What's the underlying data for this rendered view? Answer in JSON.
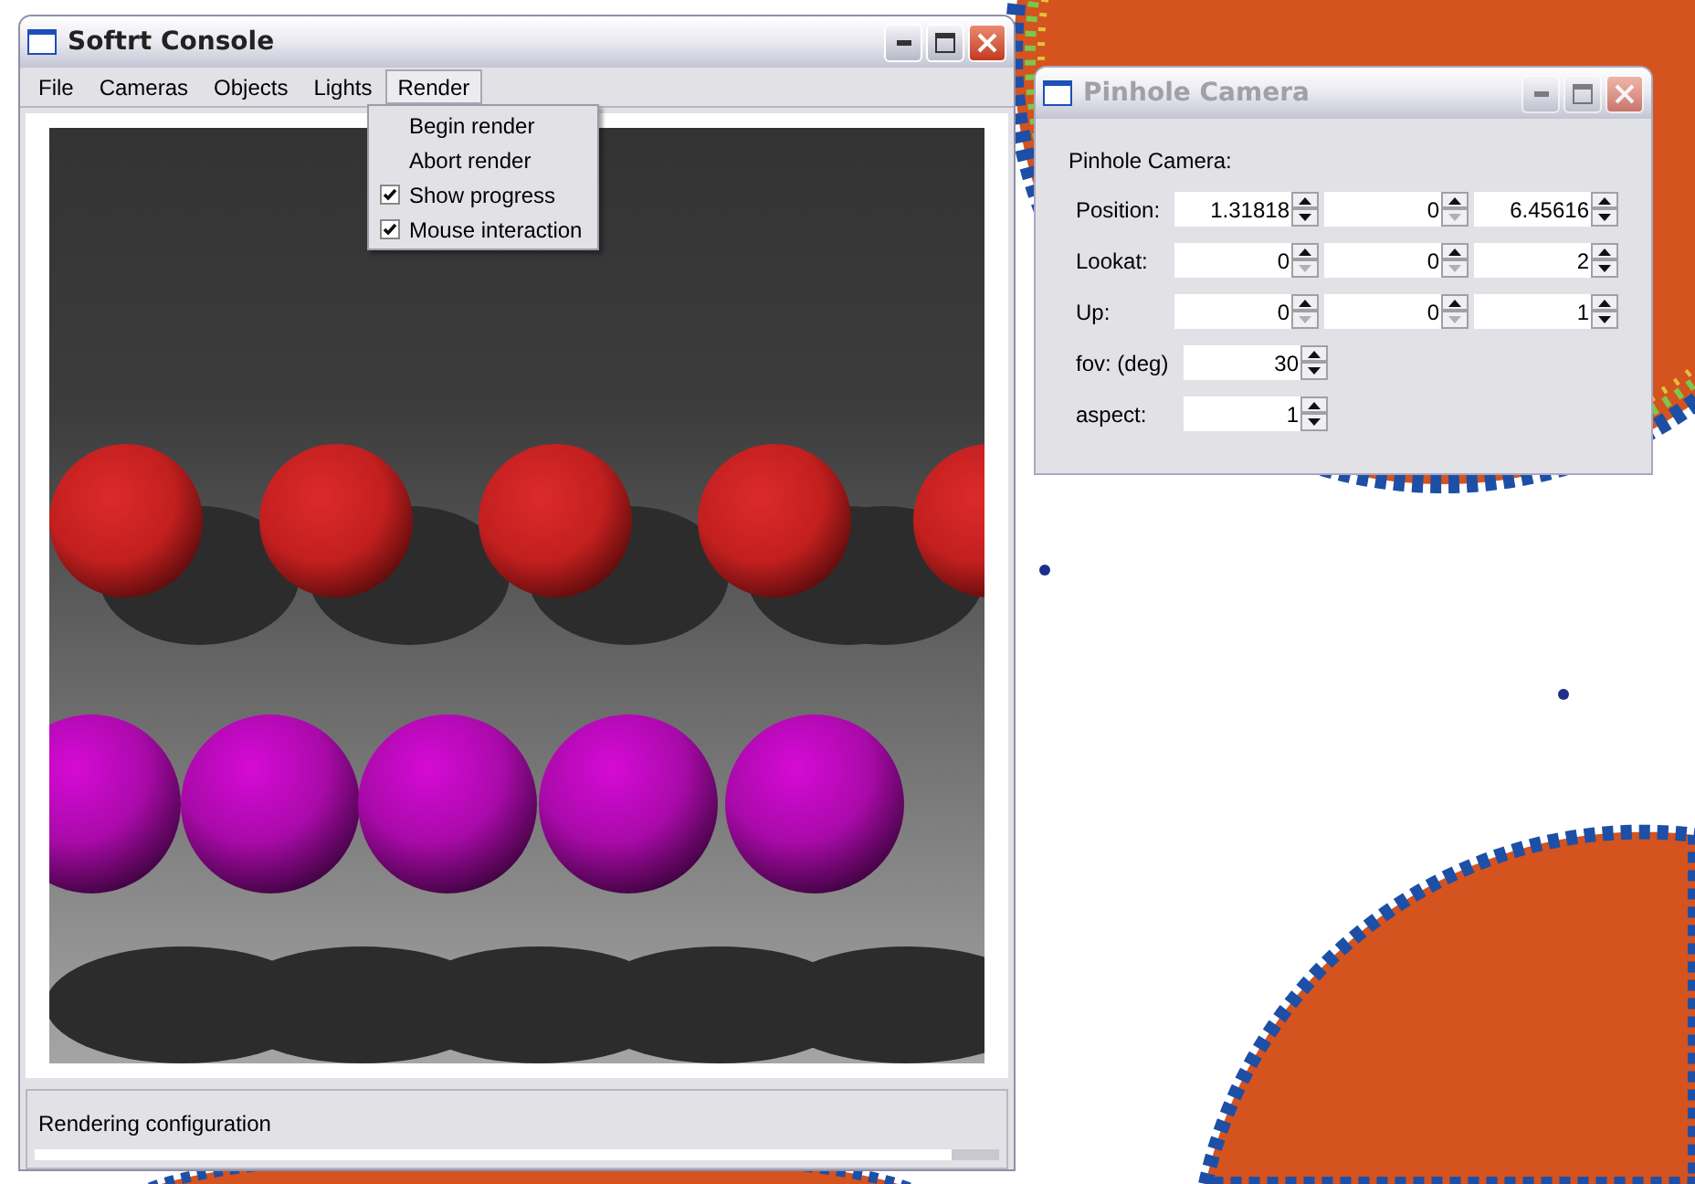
{
  "console_window": {
    "title": "Softrt Console",
    "menu_bar": [
      {
        "label": "File",
        "selected": false
      },
      {
        "label": "Cameras",
        "selected": false
      },
      {
        "label": "Objects",
        "selected": false
      },
      {
        "label": "Lights",
        "selected": false
      },
      {
        "label": "Render",
        "selected": true
      }
    ],
    "render_menu": [
      {
        "kind": "action",
        "label": "Begin render"
      },
      {
        "kind": "action",
        "label": "Abort render"
      },
      {
        "kind": "check",
        "label": "Show progress",
        "checked": true
      },
      {
        "kind": "check",
        "label": "Mouse interaction",
        "checked": true
      }
    ],
    "status_text": "Rendering configuration",
    "progress": {
      "level": 0.95
    }
  },
  "camera_window": {
    "title": "Pinhole Camera",
    "active": false,
    "heading": "Pinhole Camera:",
    "rows": [
      {
        "label": "Position:",
        "fields": [
          {
            "value": "1.31818",
            "down_enabled": true
          },
          {
            "value": "0",
            "down_enabled": false
          },
          {
            "value": "6.45616",
            "down_enabled": true
          }
        ]
      },
      {
        "label": "Lookat:",
        "fields": [
          {
            "value": "0",
            "down_enabled": false
          },
          {
            "value": "0",
            "down_enabled": false
          },
          {
            "value": "2",
            "down_enabled": true
          }
        ]
      },
      {
        "label": "Up:",
        "fields": [
          {
            "value": "0",
            "down_enabled": false
          },
          {
            "value": "0",
            "down_enabled": false
          },
          {
            "value": "1",
            "down_enabled": true
          }
        ]
      },
      {
        "label": "fov: (deg)",
        "fields": [
          {
            "value": "30",
            "down_enabled": true
          }
        ]
      },
      {
        "label": "aspect:",
        "fields": [
          {
            "value": "1",
            "down_enabled": true
          }
        ]
      }
    ]
  }
}
